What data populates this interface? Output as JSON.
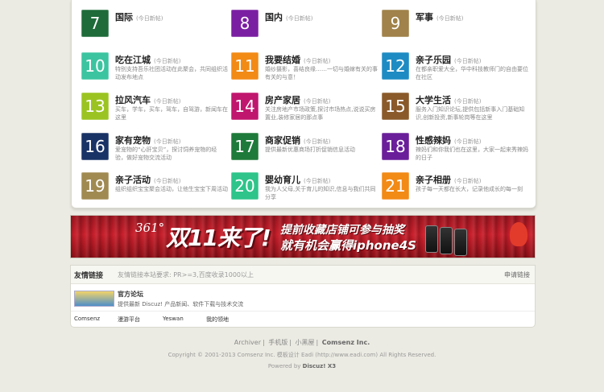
{
  "forums": [
    {
      "num": "7",
      "name": "国际",
      "today": "(今日新帖)",
      "desc": "",
      "color": "#1f6b3a"
    },
    {
      "num": "8",
      "name": "国内",
      "today": "(今日新帖)",
      "desc": "",
      "color": "#7b1fa2"
    },
    {
      "num": "9",
      "name": "军事",
      "today": "(今日新帖)",
      "desc": "",
      "color": "#a0824a"
    },
    {
      "num": "10",
      "name": "吃在江城",
      "today": "(今日新帖)",
      "desc": "特别支持吾乐社团活动在此聚会，共同组织活动发布地点",
      "color": "#3cc4a0"
    },
    {
      "num": "11",
      "name": "我要结婚",
      "today": "(今日新帖)",
      "desc": "婚纱摄影，喜结良缘……一切与婚嫁有关的事有关的与意！",
      "color": "#f28a16"
    },
    {
      "num": "12",
      "name": "亲子乐园",
      "today": "(今日新帖)",
      "desc": "在都亲职爱大全，华中科技教师门的自由要位在社区",
      "color": "#1e8bc3"
    },
    {
      "num": "13",
      "name": "拉风汽车",
      "today": "(今日新帖)",
      "desc": "买车，学车，买车，驾车，自驾游，新闻车在这里",
      "color": "#9bc422"
    },
    {
      "num": "14",
      "name": "房产家居",
      "today": "(今日新帖)",
      "desc": "关注房地产市场政策,探讨市场热点,说说买房置业,装修家居的那点事",
      "color": "#c0166e"
    },
    {
      "num": "15",
      "name": "大学生活",
      "today": "(今日新帖)",
      "desc": "服务入门知识论坛,提供包括新事入门基础知识,创新投资,新事轮岗等在这里",
      "color": "#8a5a2a"
    },
    {
      "num": "16",
      "name": "家有宠物",
      "today": "(今日新帖)",
      "desc": "爱宠物的“心肝宝贝”，探讨饲养宠物的经验，做好宠物交流活动",
      "color": "#1a3366"
    },
    {
      "num": "17",
      "name": "商家促销",
      "today": "(今日新帖)",
      "desc": "提供最新优惠商场打折促销信息活动",
      "color": "#1e7a3a"
    },
    {
      "num": "18",
      "name": "性感辣妈",
      "today": "(今日新帖)",
      "desc": "辣妈们和你我们也在这里，大家一起来秀辣妈的日子",
      "color": "#6a1e9a"
    },
    {
      "num": "19",
      "name": "亲子活动",
      "today": "(今日新帖)",
      "desc": "组织组织宝宝聚会活动，让他生宝宝下周活动",
      "color": "#a08a52"
    },
    {
      "num": "20",
      "name": "婴幼育儿",
      "today": "(今日新帖)",
      "desc": "我为人父母,关于育儿的知识,信息与我们共同分享",
      "color": "#2ec48a"
    },
    {
      "num": "21",
      "name": "亲子相册",
      "today": "(今日新帖)",
      "desc": "孩子每一天都在长大，记录他成长的每一刻",
      "color": "#f28a16"
    }
  ],
  "banner": {
    "logo": "361°",
    "main": "双11来了!",
    "line1": "提前收藏店铺可参与抽奖",
    "line2": "就有机会赢得iphone4S"
  },
  "links": {
    "title": "友情链接",
    "requirement": "友情链接本站要求: PR>=3,百度收录1000以上",
    "apply": "申请链接",
    "featured_name": "官方论坛",
    "featured_desc": "提供最新 Discuz! 产品新闻、软件下载与技术交流",
    "text_links": [
      "Comsenz",
      "漫游平台",
      "Yeswan",
      "我的领地"
    ]
  },
  "footer": {
    "nav": [
      "Archiver",
      "手机版",
      "小黑屋"
    ],
    "brand": "Comsenz Inc.",
    "copyright": "Copyright © 2001-2013 Comsenz Inc. 模板设计 Eadi (http://www.eadi.com) All Rights Reserved.",
    "powered_label": "Powered by",
    "powered_product": "Discuz! X3"
  }
}
